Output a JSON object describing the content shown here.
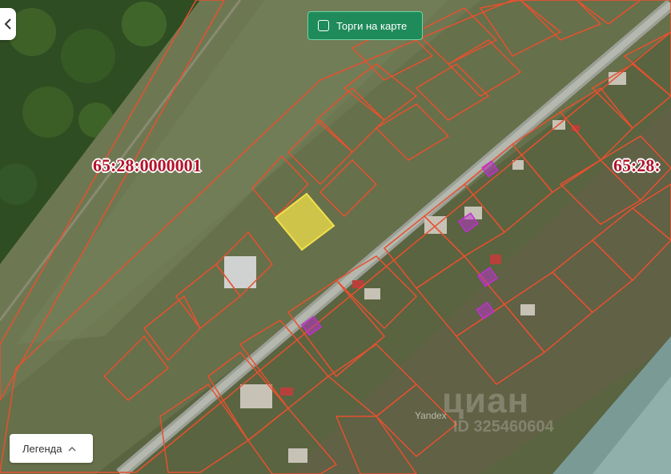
{
  "map": {
    "cadastral_labels": [
      "65:28:0000001",
      "65:28:"
    ],
    "highlighted_parcel_color": "#f2e04a",
    "parcel_border_color": "#e8502f",
    "auction_parcel_color": "#c030d0",
    "watermarks": {
      "cian": "циан",
      "listing_id": "ID 325460604",
      "provider": "Yandex"
    }
  },
  "controls": {
    "back_icon": "chevron-left-icon",
    "auction_toggle_label": "Торги на карте",
    "auction_toggle_checked": false,
    "legend_label": "Легенда",
    "legend_icon": "chevron-up-icon"
  },
  "colors": {
    "toggle_bg": "#1f8a5a",
    "label_red": "#b3132b"
  }
}
